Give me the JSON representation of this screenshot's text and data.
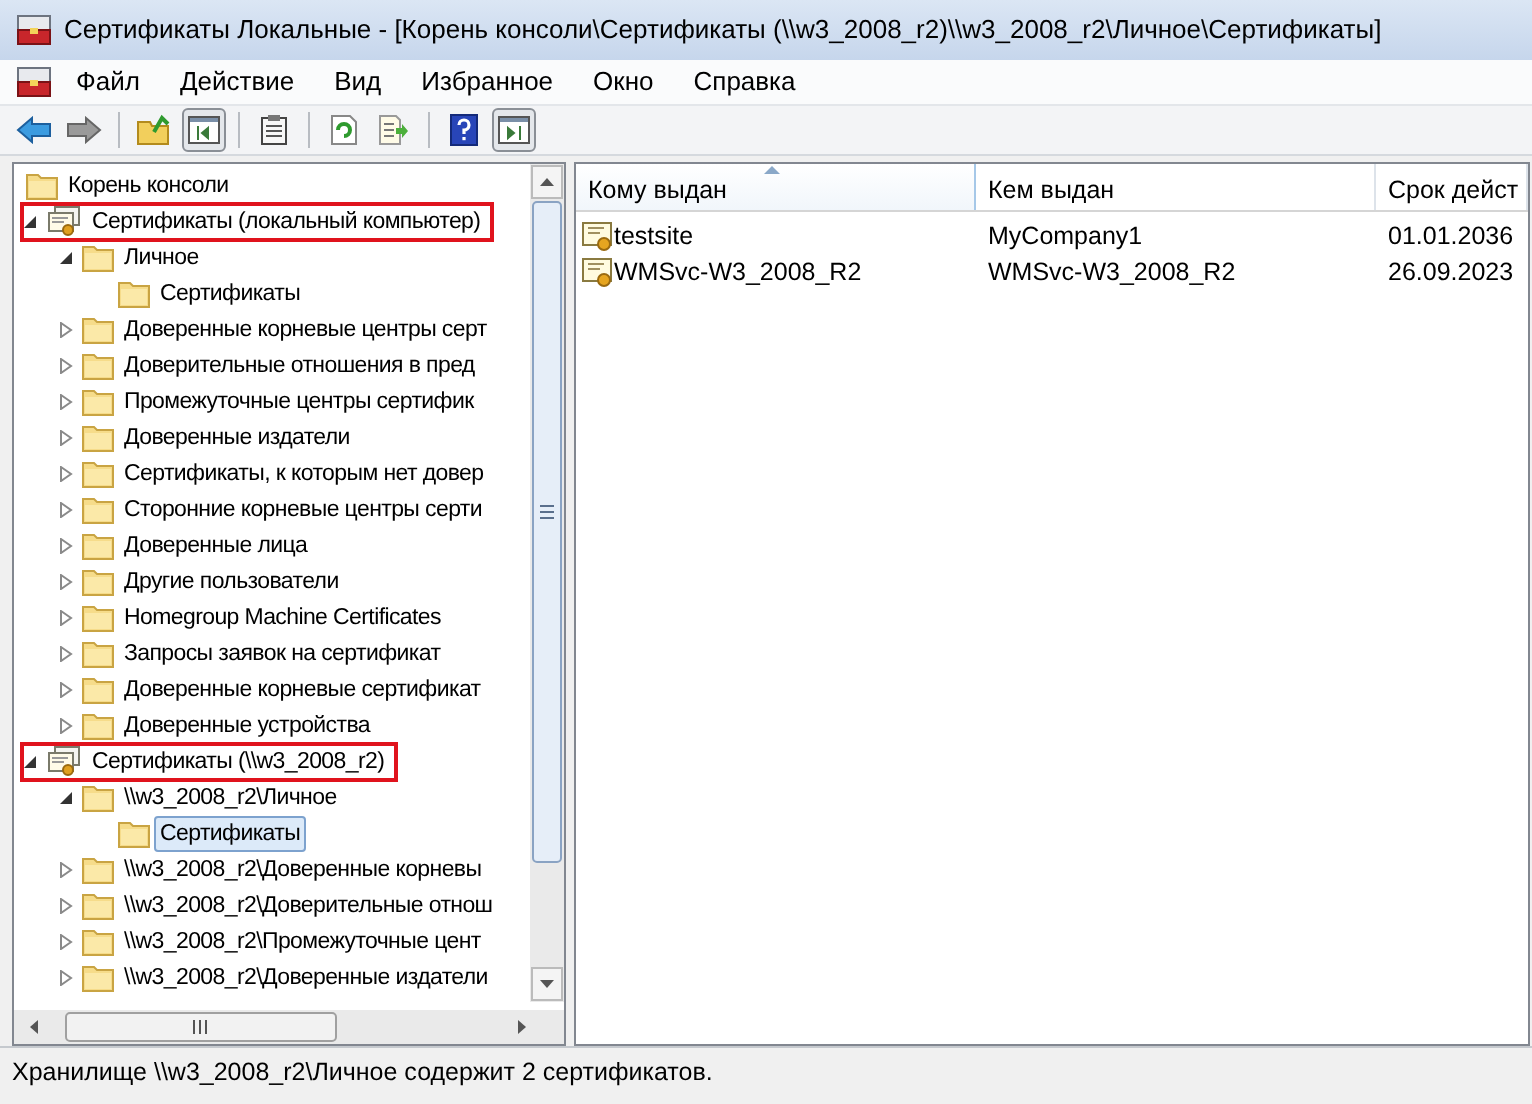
{
  "window": {
    "title": "Сертификаты Локальные - [Корень консоли\\Сертификаты (\\\\w3_2008_r2)\\\\w3_2008_r2\\Личное\\Сертификаты]"
  },
  "menu": [
    "Файл",
    "Действие",
    "Вид",
    "Избранное",
    "Окно",
    "Справка"
  ],
  "tree": [
    {
      "label": "Корень консоли",
      "kind": "folder",
      "selected": false,
      "children": [
        {
          "label": "Сертификаты (локальный компьютер)",
          "kind": "store",
          "expanded": true,
          "highlighted": true,
          "selected": false,
          "children": [
            {
              "label": "Личное",
              "kind": "folder",
              "expanded": true,
              "selected": false,
              "children": [
                {
                  "label": "Сертификаты",
                  "kind": "folder",
                  "selected": false
                }
              ]
            },
            {
              "label": "Доверенные корневые центры серт",
              "kind": "folder",
              "expanded": false,
              "selected": false
            },
            {
              "label": "Доверительные отношения в пред",
              "kind": "folder",
              "expanded": false,
              "selected": false
            },
            {
              "label": "Промежуточные центры сертифик",
              "kind": "folder",
              "expanded": false,
              "selected": false
            },
            {
              "label": "Доверенные издатели",
              "kind": "folder",
              "expanded": false,
              "selected": false
            },
            {
              "label": "Сертификаты, к которым нет довер",
              "kind": "folder",
              "expanded": false,
              "selected": false
            },
            {
              "label": "Сторонние корневые центры серти",
              "kind": "folder",
              "expanded": false,
              "selected": false
            },
            {
              "label": "Доверенные лица",
              "kind": "folder",
              "expanded": false,
              "selected": false
            },
            {
              "label": "Другие пользователи",
              "kind": "folder",
              "expanded": false,
              "selected": false
            },
            {
              "label": "Homegroup Machine Certificates",
              "kind": "folder",
              "expanded": false,
              "selected": false
            },
            {
              "label": "Запросы заявок на сертификат",
              "kind": "folder",
              "expanded": false,
              "selected": false
            },
            {
              "label": "Доверенные корневые сертификат",
              "kind": "folder",
              "expanded": false,
              "selected": false
            },
            {
              "label": "Доверенные устройства",
              "kind": "folder",
              "expanded": false,
              "selected": false
            }
          ]
        },
        {
          "label": "Сертификаты (\\\\w3_2008_r2)",
          "kind": "store",
          "expanded": true,
          "highlighted": true,
          "selected": false,
          "children": [
            {
              "label": "\\\\w3_2008_r2\\Личное",
              "kind": "folder",
              "expanded": true,
              "selected": false,
              "children": [
                {
                  "label": "Сертификаты",
                  "kind": "folder",
                  "selected": true
                }
              ]
            },
            {
              "label": "\\\\w3_2008_r2\\Доверенные корневы",
              "kind": "folder",
              "expanded": false,
              "selected": false
            },
            {
              "label": "\\\\w3_2008_r2\\Доверительные отнош",
              "kind": "folder",
              "expanded": false,
              "selected": false
            },
            {
              "label": "\\\\w3_2008_r2\\Промежуточные цент",
              "kind": "folder",
              "expanded": false,
              "selected": false
            },
            {
              "label": "\\\\w3_2008_r2\\Доверенные издатели",
              "kind": "folder",
              "expanded": false,
              "selected": false
            }
          ]
        }
      ]
    }
  ],
  "table": {
    "columns": [
      {
        "label": "Кому выдан",
        "sorted": true
      },
      {
        "label": "Кем выдан",
        "sorted": false
      },
      {
        "label": "Срок дейст",
        "sorted": false
      }
    ],
    "rows": [
      [
        "testsite",
        "MyCompany1",
        "01.01.2036"
      ],
      [
        "WMSvc-W3_2008_R2",
        "WMSvc-W3_2008_R2",
        "26.09.2023"
      ]
    ]
  },
  "status_bar": "Хранилище \\\\w3_2008_r2\\Личное содержит 2 сертификатов."
}
